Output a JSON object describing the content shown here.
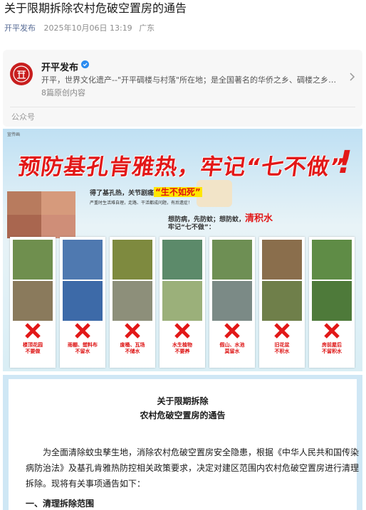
{
  "article": {
    "title": "关于限期拆除农村危破空置房的通告",
    "author": "开平发布",
    "date": "2025年10月06日 13:19",
    "location": "广东"
  },
  "account": {
    "name": "开平发布",
    "description": "开平，世界文化遗产--\"开平碉楼与村落\"所在地；是全国著名的华侨之乡、碉楼之乡、建...",
    "original_count": "8篇原创内容",
    "type": "公众号"
  },
  "poster": {
    "tag": "宣传画",
    "headline": "预防基孔肯雅热，牢记“七不做”",
    "exclaim": "!",
    "line1_prefix": "得了基孔热，关节剧痛",
    "line1_highlight": "“生不如死”",
    "line2": "严重时生活难自理，走路、干活都成问题，有后遗症！",
    "line3_prefix": "想防病，先防蚊；想防蚊，",
    "line3_highlight": "清积水",
    "line4": "牢记“七不做”：",
    "panels": [
      {
        "caption": "楼顶花园\n不要做"
      },
      {
        "caption": "雨棚、塑料布\n不留水"
      },
      {
        "caption": "废桶、瓦场\n不储水"
      },
      {
        "caption": "水生植物\n不要养"
      },
      {
        "caption": "假山、水池\n莫留水"
      },
      {
        "caption": "旧花盆\n不积水"
      },
      {
        "caption": "房前屋后\n不留积水"
      }
    ]
  },
  "notice": {
    "title_line1": "关于限期拆除",
    "title_line2": "农村危破空置房的通告",
    "body": "为全面清除蚊虫孳生地，消除农村危破空置房安全隐患，根据《中华人民共和国传染病防治法》及基孔肯雅热防控相关政策要求，决定对建区范围内农村危破空置房进行清理拆除。现将有关事项通告如下：",
    "section1": "一、清理拆除范围"
  },
  "colors": {
    "accent_red": "#e21818",
    "link_blue": "#576b95",
    "notice_border": "#cfe7f5"
  }
}
